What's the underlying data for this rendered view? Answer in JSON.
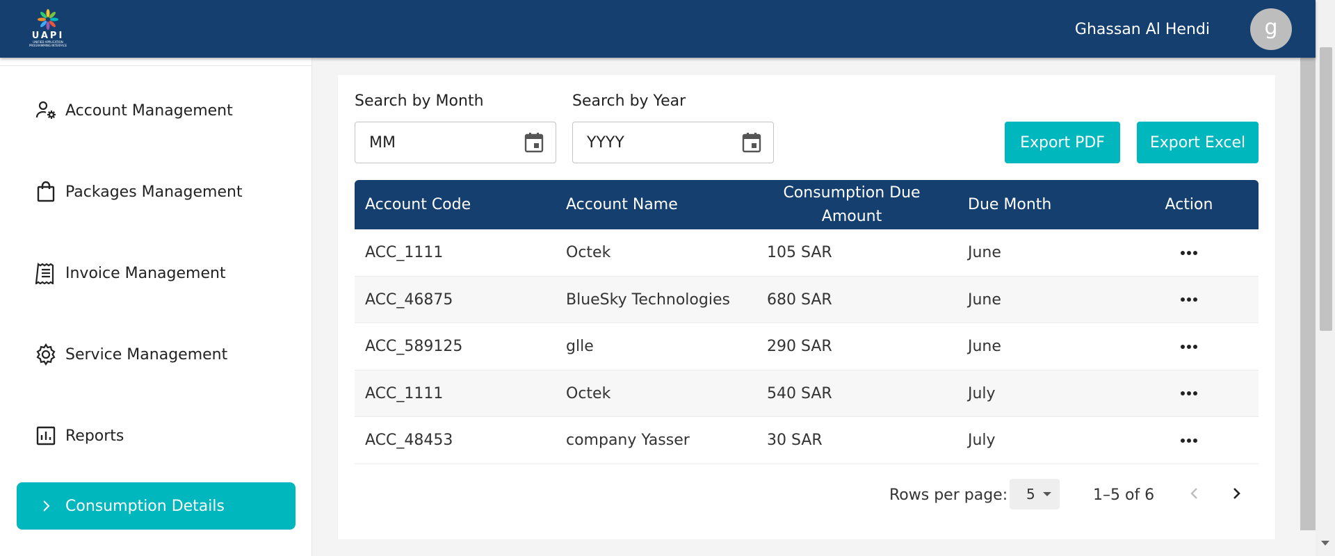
{
  "header": {
    "logo_word": "UAPI",
    "logo_sub": "UNIFIED APPLICATION PROGRAMMING INTERFACE",
    "user_name": "Ghassan Al Hendi",
    "avatar_letter": "g",
    "color": "#143f6e"
  },
  "sidebar": {
    "items": [
      {
        "label": "Account Management",
        "icon": "user-gear-icon",
        "active": false
      },
      {
        "label": "Packages Management",
        "icon": "shopping-bag-icon",
        "active": false
      },
      {
        "label": "Invoice Management",
        "icon": "receipt-icon",
        "active": false
      },
      {
        "label": "Service Management",
        "icon": "gear-icon",
        "active": false
      },
      {
        "label": "Reports",
        "icon": "bar-chart-icon",
        "active": false
      },
      {
        "label": "Consumption Details",
        "icon": "chevron-right-icon",
        "active": true
      }
    ],
    "active_color": "#00b7bd"
  },
  "filters": {
    "month_label": "Search by Month",
    "month_placeholder": "MM",
    "year_label": "Search by Year",
    "year_placeholder": "YYYY"
  },
  "actions": {
    "export_pdf": "Export PDF",
    "export_excel": "Export Excel"
  },
  "table": {
    "columns": [
      "Account Code",
      "Account Name",
      "Consumption Due Amount",
      "Due Month",
      "Action"
    ],
    "rows": [
      {
        "code": "ACC_1111",
        "name": "Octek",
        "amount": "105 SAR",
        "month": "June"
      },
      {
        "code": "ACC_46875",
        "name": "BlueSky Technologies",
        "amount": "680 SAR",
        "month": "June"
      },
      {
        "code": "ACC_589125",
        "name": "glle",
        "amount": "290 SAR",
        "month": "June"
      },
      {
        "code": "ACC_1111",
        "name": "Octek",
        "amount": "540 SAR",
        "month": "July"
      },
      {
        "code": "ACC_48453",
        "name": "company Yasser",
        "amount": "30 SAR",
        "month": "July"
      }
    ]
  },
  "pagination": {
    "rows_per_page_label": "Rows per page:",
    "rows_per_page_value": "5",
    "range_text": "1–5 of 6"
  }
}
